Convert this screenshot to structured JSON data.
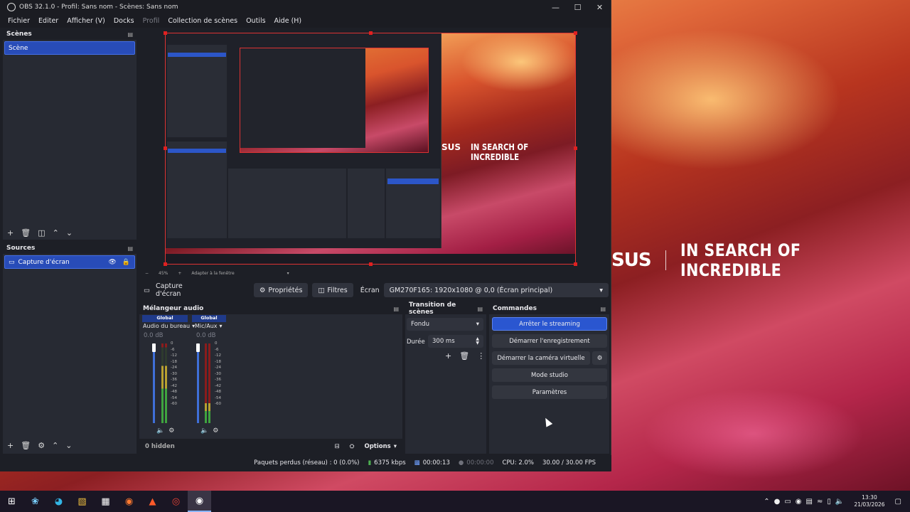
{
  "window": {
    "title": "OBS 32.1.0 - Profil: Sans nom - Scènes: Sans nom"
  },
  "menu": [
    "Fichier",
    "Editer",
    "Afficher (V)",
    "Docks",
    "Profil",
    "Collection de scènes",
    "Outils",
    "Aide (H)"
  ],
  "scenes": {
    "title": "Scènes",
    "items": [
      "Scène"
    ]
  },
  "sources": {
    "title": "Sources",
    "items": [
      {
        "label": "Capture d'écran"
      }
    ]
  },
  "preview": {
    "zoom": "45%",
    "fit": "Adapter à la fenêtre",
    "brand": "SUS",
    "tagline": "IN SEARCH OF INCREDIBLE"
  },
  "source_bar": {
    "name": "Capture d'écran",
    "properties": "Propriétés",
    "filters": "Filtres",
    "screen_label": "Écran",
    "screen_value": "GM270F165: 1920x1080 @ 0,0 (Écran principal)"
  },
  "mixer": {
    "title": "Mélangeur audio",
    "channels": [
      {
        "badge": "Global",
        "name": "Audio du bureau",
        "db": "0.0 dB",
        "level": 0.72,
        "peak": 0.95
      },
      {
        "badge": "Global",
        "name": "Mic/Aux",
        "db": "0.0 dB",
        "level": 0.25,
        "peak": 0.05
      }
    ],
    "ticks": [
      "0",
      "-6",
      "-12",
      "-18",
      "-24",
      "-30",
      "-36",
      "-42",
      "-48",
      "-54",
      "-60"
    ],
    "hidden": "0 hidden",
    "options": "Options"
  },
  "transitions": {
    "title": "Transition de scènes",
    "type": "Fondu",
    "duration_label": "Durée",
    "duration": "300 ms"
  },
  "controls": {
    "title": "Commandes",
    "stop_streaming": "Arrêter le streaming",
    "start_recording": "Démarrer l'enregistrement",
    "start_virtualcam": "Démarrer la caméra virtuelle",
    "studio_mode": "Mode studio",
    "settings": "Paramètres"
  },
  "status": {
    "dropped": "Paquets perdus (réseau) : 0 (0.0%)",
    "bitrate": "6375 kbps",
    "stream_time": "00:00:13",
    "rec_time": "00:00:00",
    "cpu": "CPU: 2.0%",
    "fps": "30.00 / 30.00 FPS"
  },
  "desktop": {
    "brand": "SUS",
    "tagline": "IN SEARCH OF INCREDIBLE"
  },
  "taskbar": {
    "time": "13:30",
    "date": "21/03/2026"
  },
  "colors": {
    "accent": "#2a56d0",
    "panel": "#272a33",
    "bg": "#1d1f26"
  }
}
